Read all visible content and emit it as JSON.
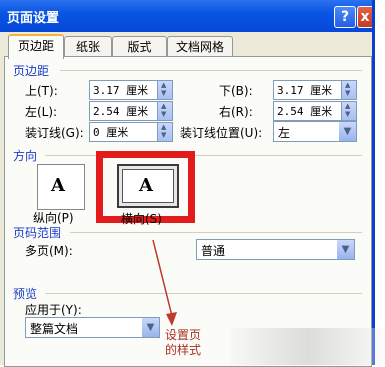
{
  "window": {
    "title": "页面设置",
    "help_label": "?",
    "close_label": "x"
  },
  "tabs": [
    "页边距",
    "纸张",
    "版式",
    "文档网格"
  ],
  "margins": {
    "group_label": "页边距",
    "top_label": "上(T):",
    "top_value": "3.17 厘米",
    "bottom_label": "下(B):",
    "bottom_value": "3.17 厘米",
    "left_label": "左(L):",
    "left_value": "2.54 厘米",
    "right_label": "右(R):",
    "right_value": "2.54 厘米",
    "gutter_label": "装订线(G):",
    "gutter_value": "0 厘米",
    "gutter_pos_label": "装订线位置(U):",
    "gutter_pos_value": "左"
  },
  "orientation": {
    "group_label": "方向",
    "portrait_label": "纵向(P)",
    "landscape_label": "横向(S)",
    "glyph": "A"
  },
  "pages": {
    "group_label": "页码范围",
    "multiple_label": "多页(M):",
    "multiple_value": "普通"
  },
  "preview": {
    "group_label": "预览",
    "apply_label": "应用于(Y):",
    "apply_value": "整篇文档"
  },
  "annotation": {
    "line1": "设置页",
    "line2": "的样式",
    "color": "#e31b1b"
  }
}
